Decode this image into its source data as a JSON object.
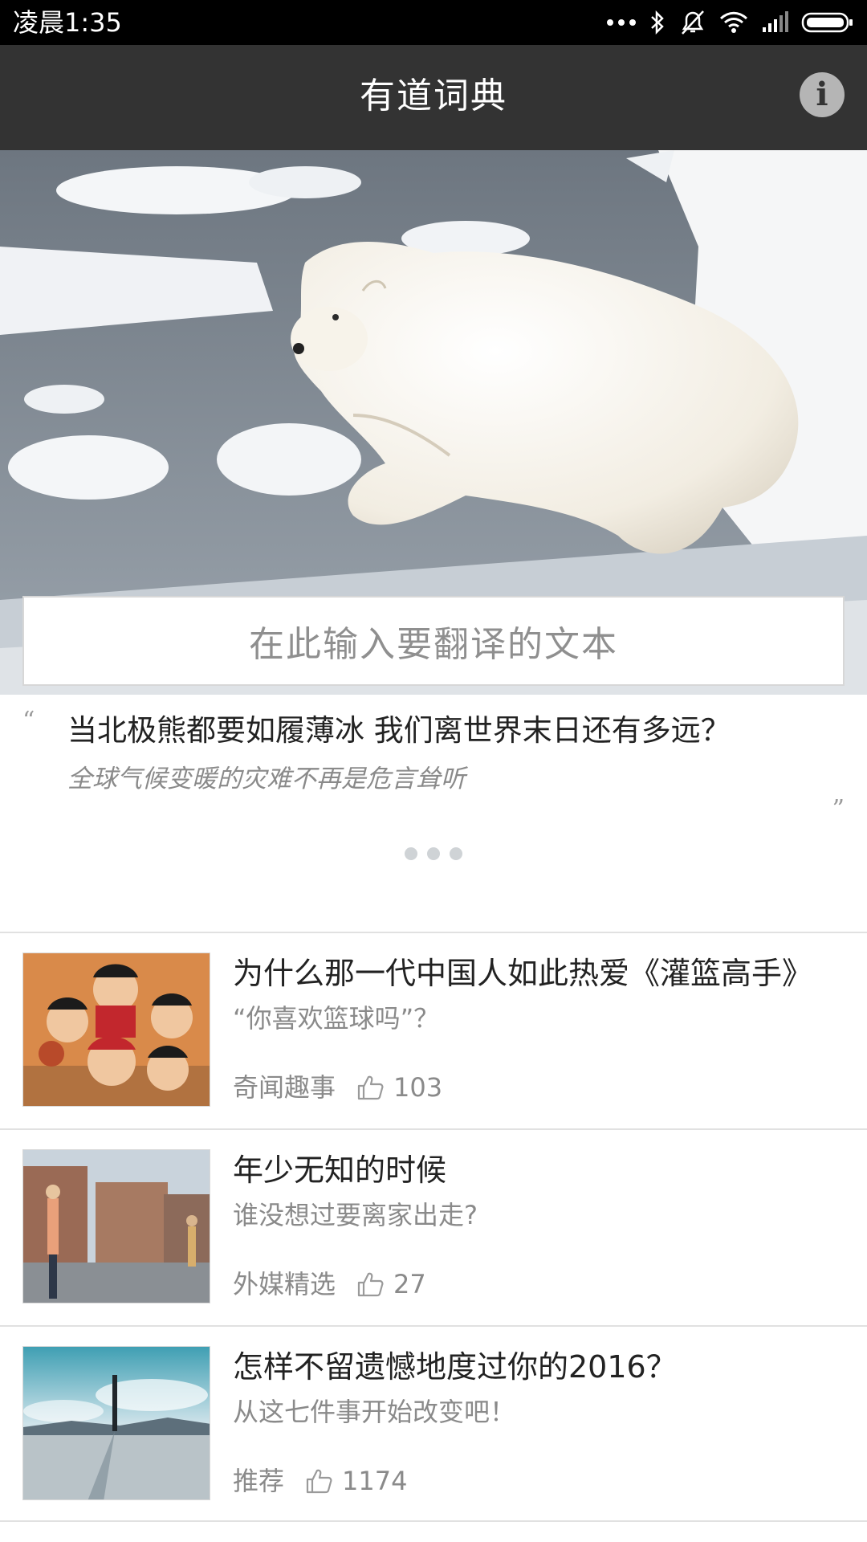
{
  "status_bar": {
    "time": "凌晨1:35"
  },
  "app_bar": {
    "title": "有道词典",
    "info_label": "i"
  },
  "search": {
    "placeholder": "在此输入要翻译的文本"
  },
  "featured": {
    "open_quote": "“",
    "close_quote": "”",
    "title": "当北极熊都要如履薄冰 我们离世界末日还有多远？",
    "subtitle": "全球气候变暖的灾难不再是危言耸听",
    "pages": 3
  },
  "feed": [
    {
      "title": "为什么那一代中国人如此热爱《灌篮高手》",
      "subtitle": "“你喜欢篮球吗”？",
      "category": "奇闻趣事",
      "likes": "103"
    },
    {
      "title": "年少无知的时候",
      "subtitle": "谁没想过要离家出走?",
      "category": "外媒精选",
      "likes": "27"
    },
    {
      "title": "怎样不留遗憾地度过你的2016？",
      "subtitle": "从这七件事开始改变吧！",
      "category": "推荐",
      "likes": "1174"
    }
  ],
  "colors": {
    "app_bar": "#333333",
    "status_bar": "#000000",
    "text_primary": "#222222",
    "text_secondary": "#8a8a8a",
    "divider": "#e1e1e1"
  },
  "icons": [
    "battery-icon",
    "signal-icon",
    "wifi-icon",
    "mute-icon",
    "bluetooth-icon",
    "more-dots-icon",
    "info-icon",
    "thumbs-up-icon"
  ]
}
